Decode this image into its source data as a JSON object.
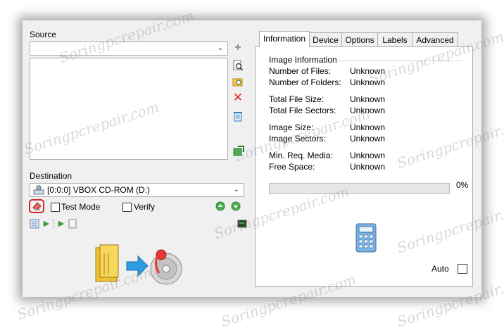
{
  "source": {
    "group_label": "Source",
    "combo_value": ""
  },
  "destination": {
    "group_label": "Destination",
    "drive_value": "[0:0:0] VBOX CD-ROM (D:)",
    "test_mode_label": "Test Mode",
    "verify_label": "Verify"
  },
  "tabs": [
    {
      "label": "Information"
    },
    {
      "label": "Device"
    },
    {
      "label": "Options"
    },
    {
      "label": "Labels"
    },
    {
      "label": "Advanced"
    }
  ],
  "info": {
    "heading": "Image Information",
    "rows": [
      {
        "label": "Number of Files:",
        "value": "Unknown"
      },
      {
        "label": "Number of Folders:",
        "value": "Unknown"
      },
      {
        "label": "Total File Size:",
        "value": "Unknown"
      },
      {
        "label": "Total File Sectors:",
        "value": "Unknown"
      },
      {
        "label": "Image Size:",
        "value": "Unknown"
      },
      {
        "label": "Image Sectors:",
        "value": "Unknown"
      },
      {
        "label": "Min. Req. Media:",
        "value": "Unknown"
      },
      {
        "label": "Free Space:",
        "value": "Unknown"
      }
    ],
    "progress_text": "0%",
    "progress_fraction": 0,
    "auto_label": "Auto"
  },
  "watermark_text": "Soringpcrepair.com",
  "icons": {
    "add": "plus-icon",
    "search": "magnify-icon",
    "browse": "folder-search-icon",
    "remove": "red-x-icon",
    "recycle": "recycle-bin-icon",
    "next": "green-arrow-icon"
  }
}
